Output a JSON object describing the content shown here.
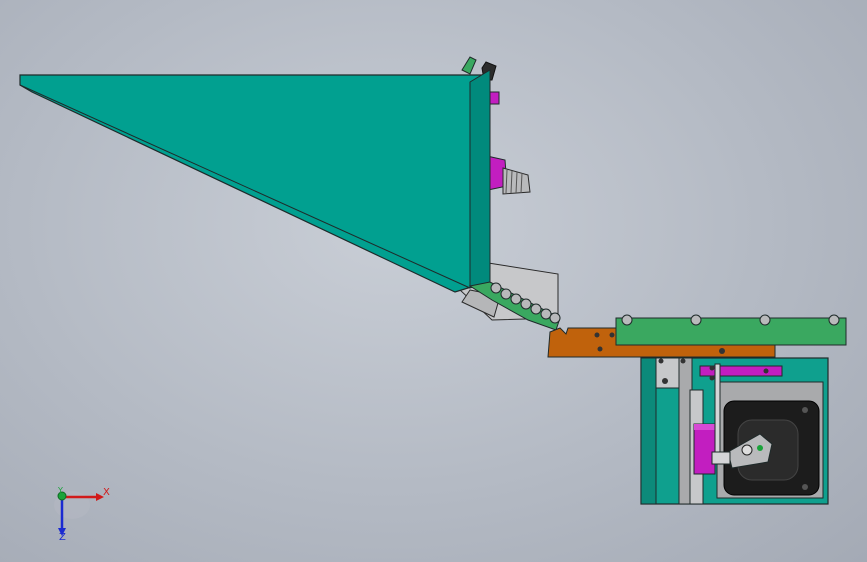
{
  "app": {
    "view": "cad-3d-viewport"
  },
  "triad": {
    "x_label": "X",
    "y_label": "Y",
    "z_label": "Z",
    "x_color": "#d11a1a",
    "y_color": "#1aa33a",
    "z_color": "#1a2ad1"
  },
  "colors": {
    "hopper": "#01a090",
    "track_green": "#3aa860",
    "plate_orange": "#c0620c",
    "base_teal": "#0fa08e",
    "accent_magenta": "#c21ec0",
    "steel_gray": "#a9aaac",
    "edge": "#1f2a2a"
  }
}
